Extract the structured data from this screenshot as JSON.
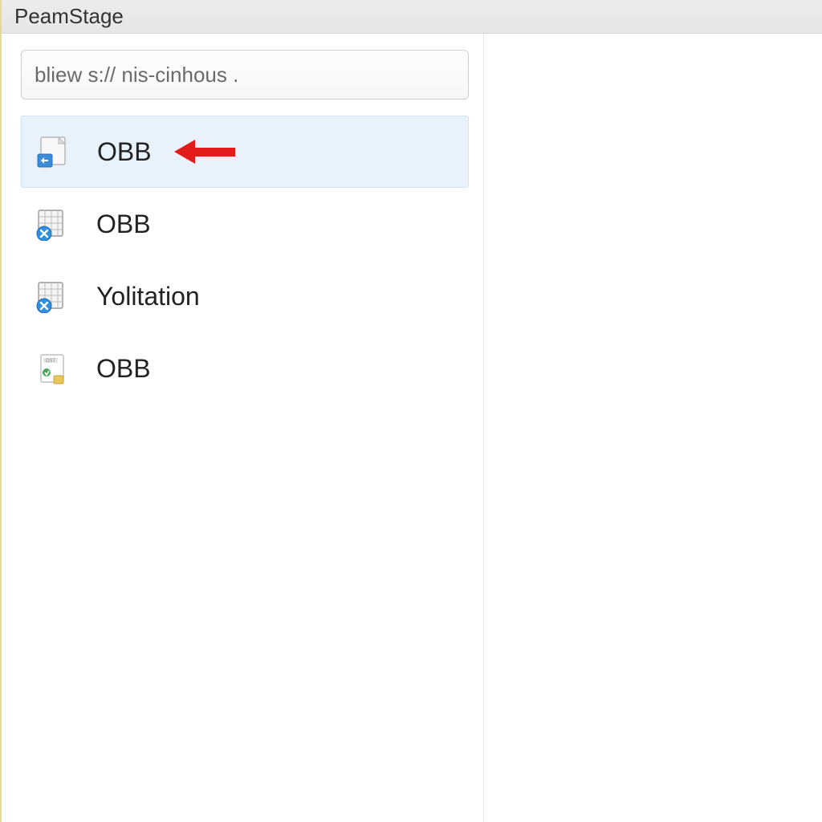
{
  "title": "PeamStage",
  "search": {
    "value": "bliew s:// nis-cinhous ."
  },
  "items": [
    {
      "label": "OBB",
      "icon": "file-link-icon",
      "selected": true,
      "arrow": true
    },
    {
      "label": "OBB",
      "icon": "grid-error-icon",
      "selected": false,
      "arrow": false
    },
    {
      "label": "Yolitation",
      "icon": "grid-error-icon",
      "selected": false,
      "arrow": false
    },
    {
      "label": "OBB",
      "icon": "doc-badge-icon",
      "selected": false,
      "arrow": false
    }
  ],
  "colors": {
    "selectedBg": "#e9f2fb",
    "arrow": "#e21b1b"
  }
}
